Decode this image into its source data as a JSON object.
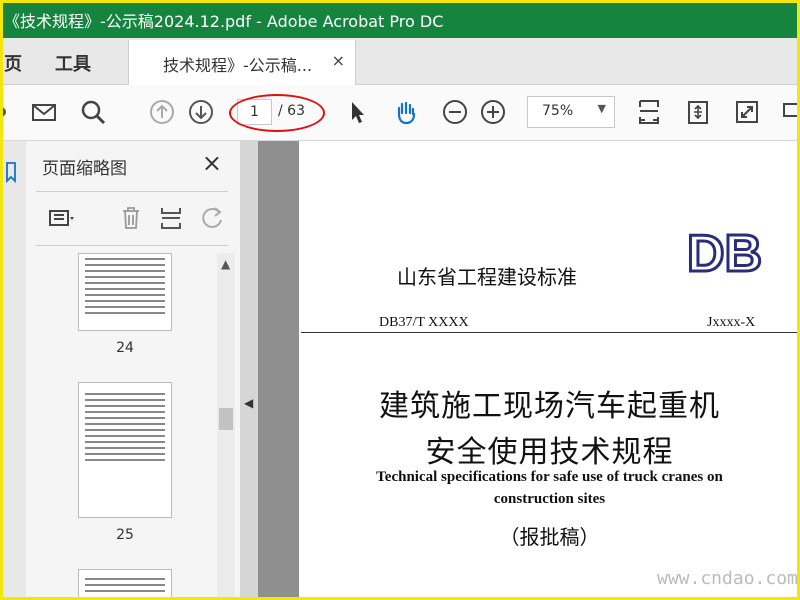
{
  "window": {
    "title": "《技术规程》-公示稿2024.12.pdf - Adobe Acrobat Pro DC"
  },
  "menubar": {
    "home": "页",
    "tools": "工具"
  },
  "doc_tab": {
    "label": "技术规程》-公示稿...",
    "close": "×"
  },
  "toolbar": {
    "page_current": "1",
    "page_total": "/ 63",
    "zoom": "75%",
    "icons": [
      "mail-icon",
      "search-icon",
      "prev-page-icon",
      "next-page-icon",
      "select-arrow-icon",
      "hand-icon",
      "zoom-out-icon",
      "zoom-in-icon",
      "fit-width-icon",
      "rotate-page-icon",
      "fullscreen-icon",
      "more-tools-icon"
    ],
    "accent": "#15843f",
    "annotation_color": "#d11111"
  },
  "panel": {
    "title": "页面缩略图",
    "close": "×",
    "thumbnails": [
      {
        "number": "24"
      },
      {
        "number": "25"
      }
    ]
  },
  "document": {
    "standard_name": "山东省工程建设标准",
    "logo": "DB",
    "code": "DB37/T XXXX",
    "jcode": "Jxxxx-X",
    "title_line1": "建筑施工现场汽车起重机",
    "title_line2": "安全使用技术规程",
    "title_en_line1": "Technical specifications for safe use of truck cranes on",
    "title_en_line2": "construction sites",
    "draft_label": "（报批稿）"
  },
  "watermark": "www.cndao.com"
}
